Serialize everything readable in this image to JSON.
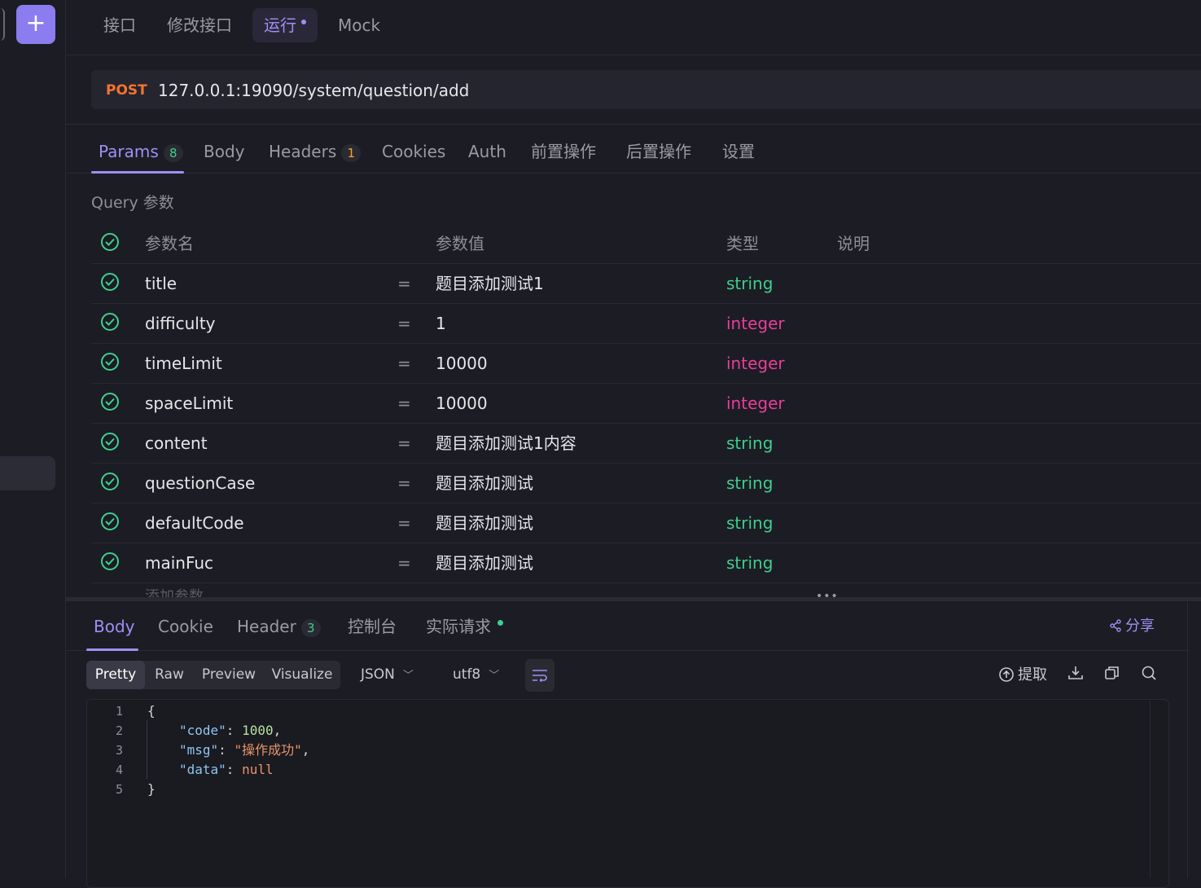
{
  "top_tabs": [
    {
      "label": "接口"
    },
    {
      "label": "修改接口"
    },
    {
      "label": "运行"
    },
    {
      "label": "Mock"
    }
  ],
  "request": {
    "method": "POST",
    "url": "127.0.0.1:19090/system/question/add"
  },
  "param_tabs": [
    {
      "label": "Params",
      "badge": "8"
    },
    {
      "label": "Body"
    },
    {
      "label": "Headers",
      "badge": "1"
    },
    {
      "label": "Cookies"
    },
    {
      "label": "Auth"
    },
    {
      "label": "前置操作"
    },
    {
      "label": "后置操作"
    },
    {
      "label": "设置"
    }
  ],
  "query_label": "Query 参数",
  "table": {
    "headers": {
      "name": "参数名",
      "value": "参数值",
      "type": "类型",
      "desc": "说明"
    },
    "rows": [
      {
        "name": "title",
        "eq": "=",
        "value": "题目添加测试1",
        "type": "string"
      },
      {
        "name": "difficulty",
        "eq": "=",
        "value": "1",
        "type": "integer"
      },
      {
        "name": "timeLimit",
        "eq": "=",
        "value": "10000",
        "type": "integer"
      },
      {
        "name": "spaceLimit",
        "eq": "=",
        "value": "10000",
        "type": "integer"
      },
      {
        "name": "content",
        "eq": "=",
        "value": "题目添加测试1内容",
        "type": "string"
      },
      {
        "name": "questionCase",
        "eq": "=",
        "value": "题目添加测试",
        "type": "string"
      },
      {
        "name": "defaultCode",
        "eq": "=",
        "value": "题目添加测试",
        "type": "string"
      },
      {
        "name": "mainFuc",
        "eq": "=",
        "value": "题目添加测试",
        "type": "string"
      }
    ],
    "add_param_placeholder": "添加参数"
  },
  "response_tabs": [
    {
      "label": "Body"
    },
    {
      "label": "Cookie"
    },
    {
      "label": "Header",
      "badge": "3"
    },
    {
      "label": "控制台"
    },
    {
      "label": "实际请求"
    }
  ],
  "share_label": "分享",
  "view_modes": [
    "Pretty",
    "Raw",
    "Preview",
    "Visualize"
  ],
  "format_select": "JSON",
  "encoding_select": "utf8",
  "extract_label": "提取",
  "code": {
    "line_numbers": [
      "1",
      "2",
      "3",
      "4",
      "5"
    ],
    "open_brace": "{",
    "close_brace": "}",
    "code_key": "\"code\"",
    "code_value": "1000",
    "msg_key": "\"msg\"",
    "msg_value": "\"操作成功\"",
    "data_key": "\"data\"",
    "data_value": "null",
    "colon": ": ",
    "comma": ","
  },
  "add_icon": "+",
  "colors": {
    "accent": "#9f8ff5",
    "method_post": "#f5732d",
    "type_string": "#3ecf8e",
    "type_integer": "#e83e9c"
  }
}
